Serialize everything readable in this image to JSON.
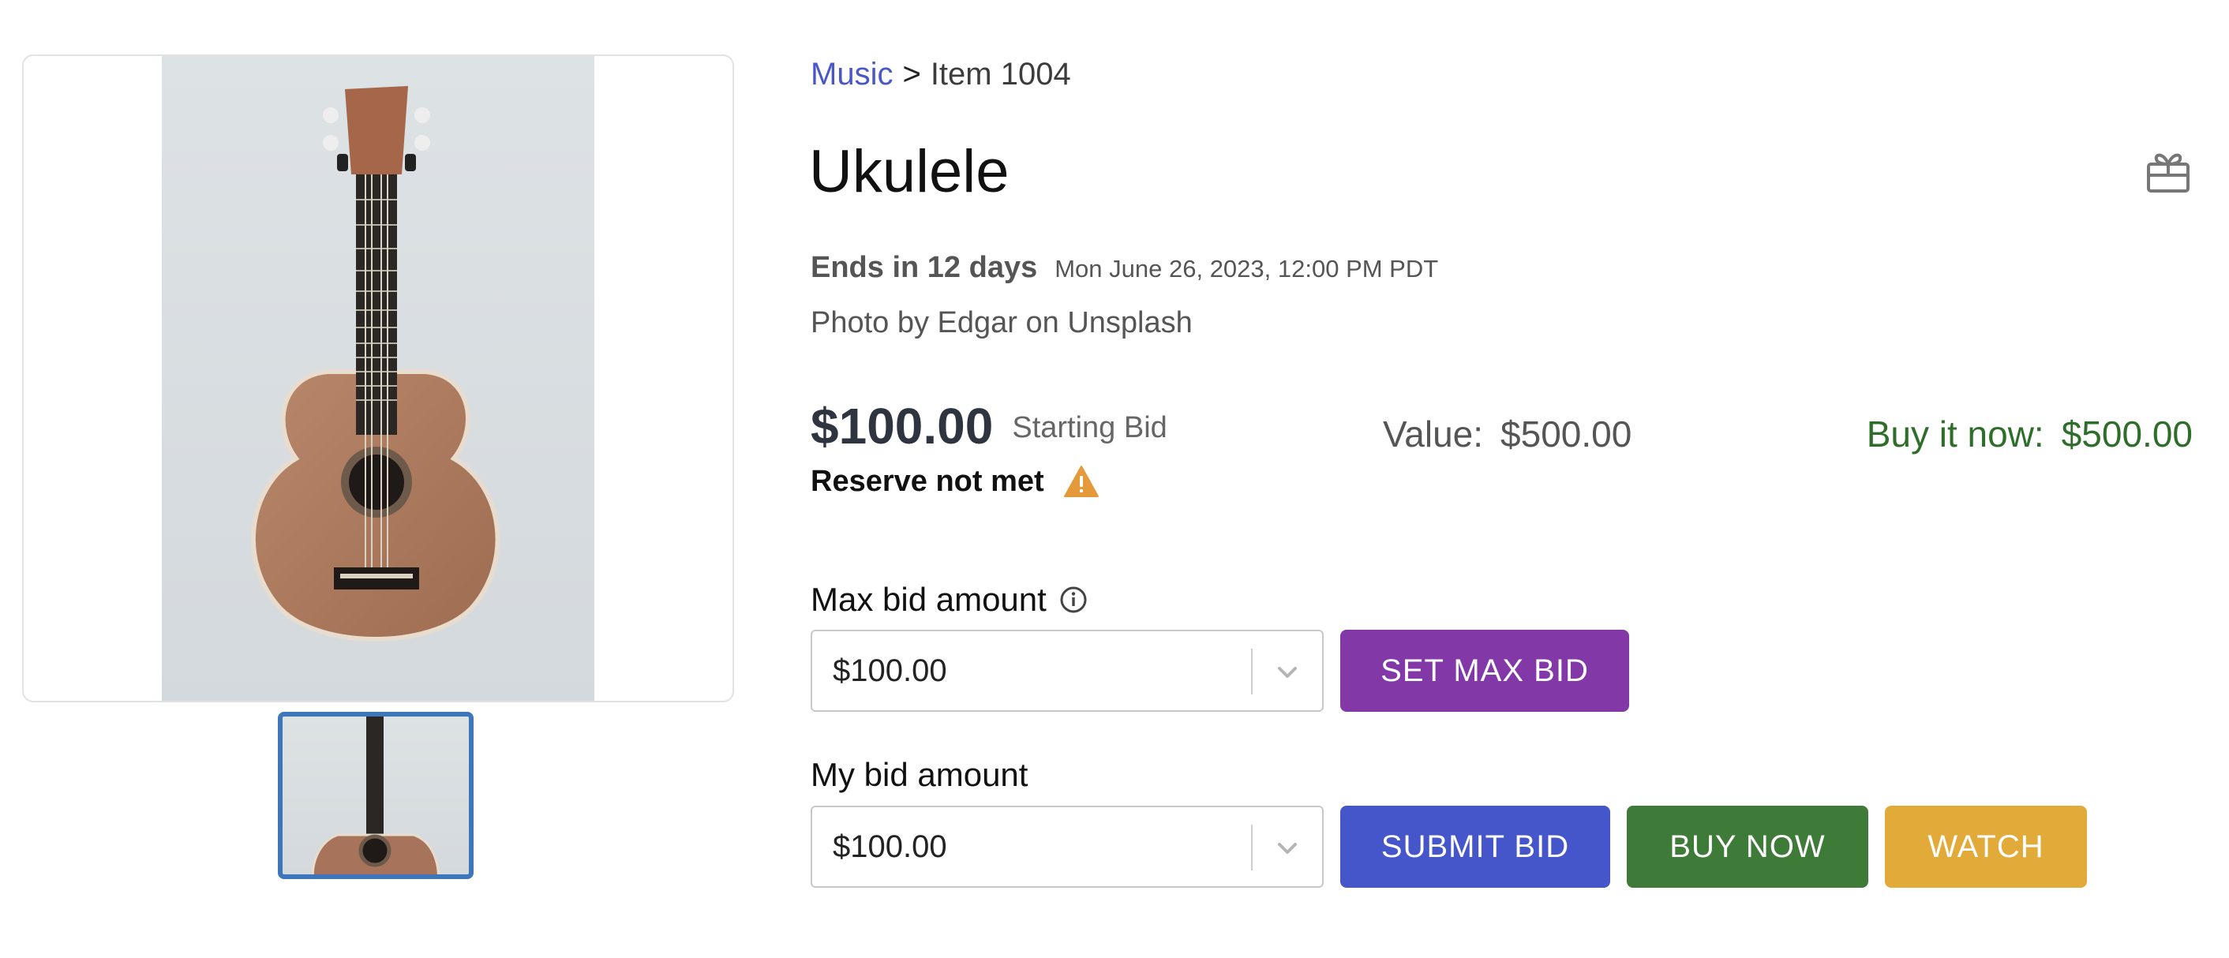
{
  "gallery": {
    "main_image_icon": "ukulele-photo",
    "expand_icon": "fullscreen-expand-icon",
    "thumbnail_icon": "ukulele-thumbnail"
  },
  "breadcrumb": {
    "category": "Music",
    "separator": ">",
    "current": "Item 1004"
  },
  "item": {
    "title": "Ukulele",
    "ends_in": "Ends in 12 days",
    "end_date": "Mon June 26, 2023, 12:00 PM PDT",
    "photo_credit": "Photo by Edgar on Unsplash",
    "gift_icon": "gift-icon"
  },
  "pricing": {
    "current_price": "$100.00",
    "price_label": "Starting Bid",
    "reserve_status": "Reserve not met",
    "reserve_icon": "warning-icon",
    "value_label": "Value:",
    "value_amount": "$500.00",
    "buy_now_label": "Buy it now:",
    "buy_now_amount": "$500.00"
  },
  "max_bid": {
    "label": "Max bid amount",
    "info_icon": "info-icon",
    "selected_value": "$100.00",
    "button_label": "SET MAX BID"
  },
  "my_bid": {
    "label": "My bid amount",
    "selected_value": "$100.00",
    "submit_label": "SUBMIT BID",
    "buy_now_button_label": "BUY NOW",
    "watch_label": "WATCH"
  },
  "colors": {
    "link": "#4a57c6",
    "buy_now_text": "#2f6e2a",
    "set_max_bid": "#8338a8",
    "submit_bid": "#4456c9",
    "buy_now": "#3e7a38",
    "watch": "#e2ab39",
    "warning": "#e49a3a",
    "thumbnail_border": "#3f76b9"
  }
}
